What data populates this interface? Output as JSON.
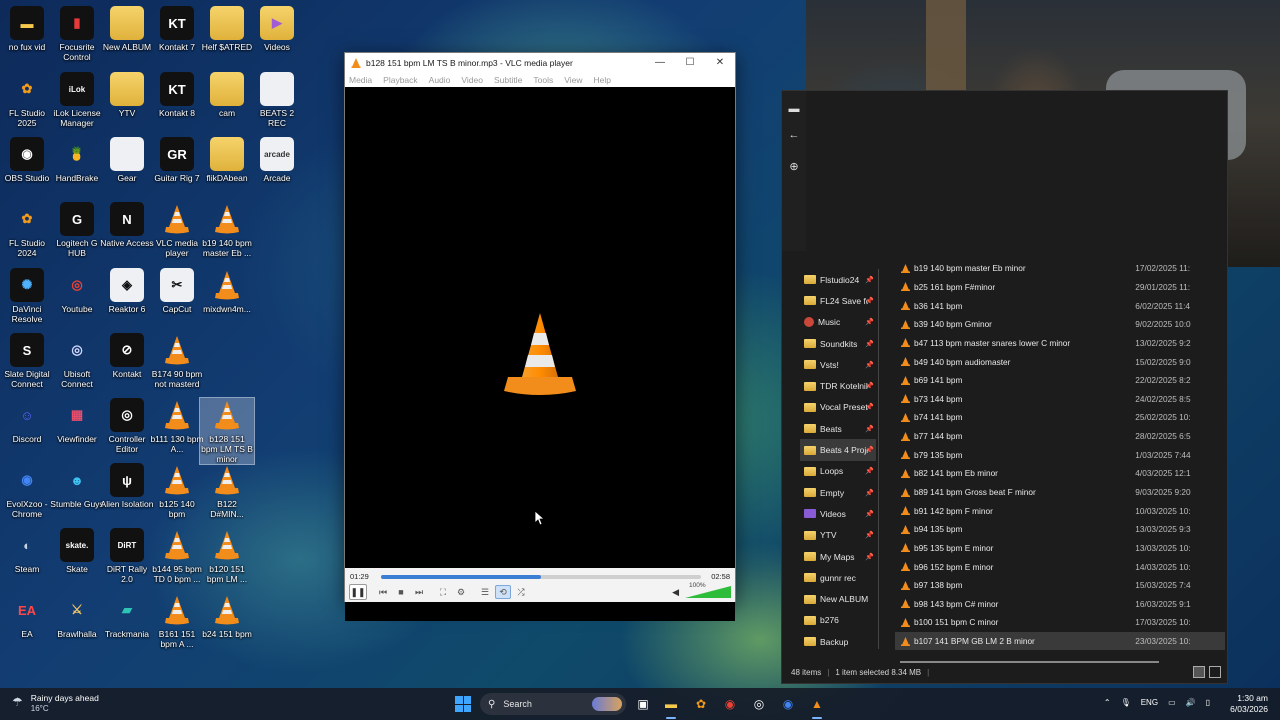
{
  "desktop": {
    "icons": [
      {
        "label": "no fux vid",
        "glyph": "▬",
        "kind": "i-dark",
        "color": "#f5c94b"
      },
      {
        "label": "Focusrite Control",
        "glyph": "▮",
        "kind": "i-dark",
        "color": "#e63b3b"
      },
      {
        "label": "New ALBUM",
        "glyph": "",
        "kind": "i-folder",
        "color": ""
      },
      {
        "label": "Kontakt 7",
        "glyph": "KT",
        "kind": "i-dark",
        "color": "#ffffff"
      },
      {
        "label": "Helf $ATRED",
        "glyph": "",
        "kind": "i-folder",
        "color": ""
      },
      {
        "label": "Videos",
        "glyph": "▶",
        "kind": "i-folder",
        "color": "#a25bd6"
      },
      {
        "label": "FL Studio 2025",
        "glyph": "✿",
        "kind": "i-vlc",
        "color": "#f29a1a"
      },
      {
        "label": "iLok License Manager",
        "glyph": "iLok",
        "kind": "i-dark",
        "color": "#ffffff"
      },
      {
        "label": "YTV",
        "glyph": "",
        "kind": "i-folder",
        "color": ""
      },
      {
        "label": "Kontakt 8",
        "glyph": "KT",
        "kind": "i-dark",
        "color": "#ffffff"
      },
      {
        "label": "cam",
        "glyph": "",
        "kind": "i-folder",
        "color": ""
      },
      {
        "label": "BEATS 2 REC",
        "glyph": "",
        "kind": "i-white",
        "color": "#333"
      },
      {
        "label": "OBS Studio",
        "glyph": "◉",
        "kind": "i-dark",
        "color": "#ffffff"
      },
      {
        "label": "HandBrake",
        "glyph": "🍍",
        "kind": "i-vlc",
        "color": "#ffffff"
      },
      {
        "label": "Gear",
        "glyph": "",
        "kind": "i-white",
        "color": "#333"
      },
      {
        "label": "Guitar Rig 7",
        "glyph": "GR",
        "kind": "i-dark",
        "color": "#ffffff"
      },
      {
        "label": "flikDAbean",
        "glyph": "",
        "kind": "i-folder",
        "color": ""
      },
      {
        "label": "Arcade",
        "glyph": "arcade",
        "kind": "i-white",
        "color": "#333"
      },
      {
        "label": "FL Studio 2024",
        "glyph": "✿",
        "kind": "i-vlc",
        "color": "#f29a1a"
      },
      {
        "label": "Logitech G HUB",
        "glyph": "G",
        "kind": "i-dark",
        "color": "#ffffff"
      },
      {
        "label": "Native Access",
        "glyph": "N",
        "kind": "i-dark",
        "color": "#ffffff"
      },
      {
        "label": "VLC media player",
        "glyph": "▲",
        "kind": "i-vlc",
        "color": "#f28c1a"
      },
      {
        "label": "b19 140 bpm master Eb ...",
        "glyph": "▲",
        "kind": "i-vlc",
        "color": "#f28c1a"
      },
      {
        "label": "DaVinci Resolve",
        "glyph": "✺",
        "kind": "i-dark",
        "color": "#4fb3ff"
      },
      {
        "label": "Youtube",
        "glyph": "◎",
        "kind": "i-vlc",
        "color": "#ea4335"
      },
      {
        "label": "Reaktor 6",
        "glyph": "◈",
        "kind": "i-white",
        "color": "#111"
      },
      {
        "label": "CapCut",
        "glyph": "✂",
        "kind": "i-white",
        "color": "#111"
      },
      {
        "label": "mixdwn4m...",
        "glyph": "▲",
        "kind": "i-vlc",
        "color": "#f28c1a"
      },
      {
        "label": "Slate Digital Connect",
        "glyph": "S",
        "kind": "i-dark",
        "color": "#ffffff"
      },
      {
        "label": "Ubisoft Connect",
        "glyph": "◎",
        "kind": "i-vlc",
        "color": "#d3d8ff"
      },
      {
        "label": "Kontakt",
        "glyph": "⊘",
        "kind": "i-dark",
        "color": "#ffffff"
      },
      {
        "label": "B174 90 bpm not masterd",
        "glyph": "▲",
        "kind": "i-vlc",
        "color": "#f28c1a"
      },
      {
        "label": "Discord",
        "glyph": "☺",
        "kind": "i-vlc",
        "color": "#5865f2"
      },
      {
        "label": "Viewfinder",
        "glyph": "▦",
        "kind": "i-vlc",
        "color": "#e94d6b"
      },
      {
        "label": "Controller Editor",
        "glyph": "◎",
        "kind": "i-dark",
        "color": "#ffffff"
      },
      {
        "label": "b111 130 bpm A...",
        "glyph": "▲",
        "kind": "i-vlc",
        "color": "#f28c1a"
      },
      {
        "label": "b128 151 bpm LM TS B minor",
        "glyph": "▲",
        "kind": "i-vlc",
        "color": "#f28c1a"
      },
      {
        "label": "EvolXzoo - Chrome",
        "glyph": "◉",
        "kind": "i-vlc",
        "color": "#4285f4"
      },
      {
        "label": "Stumble Guys",
        "glyph": "☻",
        "kind": "i-vlc",
        "color": "#3dc3f2"
      },
      {
        "label": "Alien Isolation",
        "glyph": "ψ",
        "kind": "i-dark",
        "color": "#ffffff"
      },
      {
        "label": "b125 140 bpm",
        "glyph": "▲",
        "kind": "i-vlc",
        "color": "#f28c1a"
      },
      {
        "label": "B122 D#MIN...",
        "glyph": "▲",
        "kind": "i-vlc",
        "color": "#f28c1a"
      },
      {
        "label": "Steam",
        "glyph": "◐",
        "kind": "i-vlc",
        "color": "#c7d5e0"
      },
      {
        "label": "Skate",
        "glyph": "skate.",
        "kind": "i-dark",
        "color": "#ffffff"
      },
      {
        "label": "DiRT Rally 2.0",
        "glyph": "DiRT",
        "kind": "i-dark",
        "color": "#ffffff"
      },
      {
        "label": "b144 95 bpm TD 0 bpm ...",
        "glyph": "▲",
        "kind": "i-vlc",
        "color": "#f28c1a"
      },
      {
        "label": "b120 151 bpm LM ...",
        "glyph": "▲",
        "kind": "i-vlc",
        "color": "#f28c1a"
      },
      {
        "label": "EA",
        "glyph": "EA",
        "kind": "i-vlc",
        "color": "#ff4747"
      },
      {
        "label": "Brawlhalla",
        "glyph": "⚔",
        "kind": "i-vlc",
        "color": "#e9c46a"
      },
      {
        "label": "Trackmania",
        "glyph": "▰",
        "kind": "i-vlc",
        "color": "#2ec4b6"
      },
      {
        "label": "B161 151 bpm A ...",
        "glyph": "▲",
        "kind": "i-vlc",
        "color": "#f28c1a"
      },
      {
        "label": "b24 151 bpm",
        "glyph": "▲",
        "kind": "i-vlc",
        "color": "#f28c1a"
      }
    ]
  },
  "vlc": {
    "title": "b128 151 bpm LM TS B minor.mp3 - VLC media player",
    "menu": [
      "Media",
      "Playback",
      "Audio",
      "Video",
      "Subtitle",
      "Tools",
      "View",
      "Help"
    ],
    "elapsed": "01:29",
    "duration": "02:58",
    "progress": 0.5,
    "volume_label": "100%",
    "volume": 1.0,
    "accent": "#3b7fd4"
  },
  "explorer": {
    "nav": [
      {
        "label": "Flstudio24",
        "kind": "folder"
      },
      {
        "label": "FL24 Save fol",
        "kind": "folder"
      },
      {
        "label": "Music",
        "kind": "music"
      },
      {
        "label": "Soundkits",
        "kind": "folder"
      },
      {
        "label": "Vsts!",
        "kind": "folder"
      },
      {
        "label": "TDR Kotelnik",
        "kind": "folder"
      },
      {
        "label": "Vocal Presets",
        "kind": "folder"
      },
      {
        "label": "Beats",
        "kind": "folder"
      },
      {
        "label": "Beats 4 Proje",
        "kind": "folder",
        "active": true
      },
      {
        "label": "Loops",
        "kind": "folder"
      },
      {
        "label": "Empty",
        "kind": "folder"
      },
      {
        "label": "Videos",
        "kind": "vid"
      },
      {
        "label": "YTV",
        "kind": "folder"
      },
      {
        "label": "My Maps",
        "kind": "folder"
      },
      {
        "label": "gunnr rec",
        "kind": "folder"
      },
      {
        "label": "New ALBUM",
        "kind": "folder"
      },
      {
        "label": "b276",
        "kind": "folder"
      },
      {
        "label": "Backup",
        "kind": "folder"
      }
    ],
    "files": [
      {
        "name": "b19 140 bpm master Eb minor",
        "date": "17/02/2025 11:"
      },
      {
        "name": "b25 161 bpm F#minor",
        "date": "29/01/2025 11:"
      },
      {
        "name": "b36 141 bpm",
        "date": "6/02/2025 11:4"
      },
      {
        "name": "b39 140 bpm Gminor",
        "date": "9/02/2025 10:0"
      },
      {
        "name": "b47 113 bpm master snares lower C minor",
        "date": "13/02/2025 9:2"
      },
      {
        "name": "b49 140 bpm audiomaster",
        "date": "15/02/2025 9:0"
      },
      {
        "name": "b69 141 bpm",
        "date": "22/02/2025 8:2"
      },
      {
        "name": "b73 144 bpm",
        "date": "24/02/2025 8:5"
      },
      {
        "name": "b74 141 bpm",
        "date": "25/02/2025 10:"
      },
      {
        "name": "b77 144 bpm",
        "date": "28/02/2025 6:5"
      },
      {
        "name": "b79 135 bpm",
        "date": "1/03/2025 7:44"
      },
      {
        "name": "b82 141 bpm Eb minor",
        "date": "4/03/2025 12:1"
      },
      {
        "name": "b89 141 bpm Gross beat F minor",
        "date": "9/03/2025 9:20"
      },
      {
        "name": "b91 142 bpm F minor",
        "date": "10/03/2025 10:"
      },
      {
        "name": "b94 135 bpm",
        "date": "13/03/2025 9:3"
      },
      {
        "name": "b95 135 bpm E minor",
        "date": "13/03/2025 10:"
      },
      {
        "name": "b96 152 bpm E minor",
        "date": "14/03/2025 10:"
      },
      {
        "name": "b97 138 bpm",
        "date": "15/03/2025 7:4"
      },
      {
        "name": "b98 143 bpm C# minor",
        "date": "16/03/2025 9:1"
      },
      {
        "name": "b100 151 bpm C minor",
        "date": "17/03/2025 10:"
      },
      {
        "name": "b107 141 BPM GB LM 2 B minor",
        "date": "23/03/2025 10:",
        "selected": true
      }
    ],
    "status": {
      "count": "48 items",
      "selection": "1 item selected  8.34 MB"
    }
  },
  "taskbar": {
    "weather_title": "Rainy days ahead",
    "weather_temp": "16°C",
    "search_placeholder": "Search",
    "language": "ENG",
    "time": "1:30 am",
    "date": "6/03/2026"
  }
}
